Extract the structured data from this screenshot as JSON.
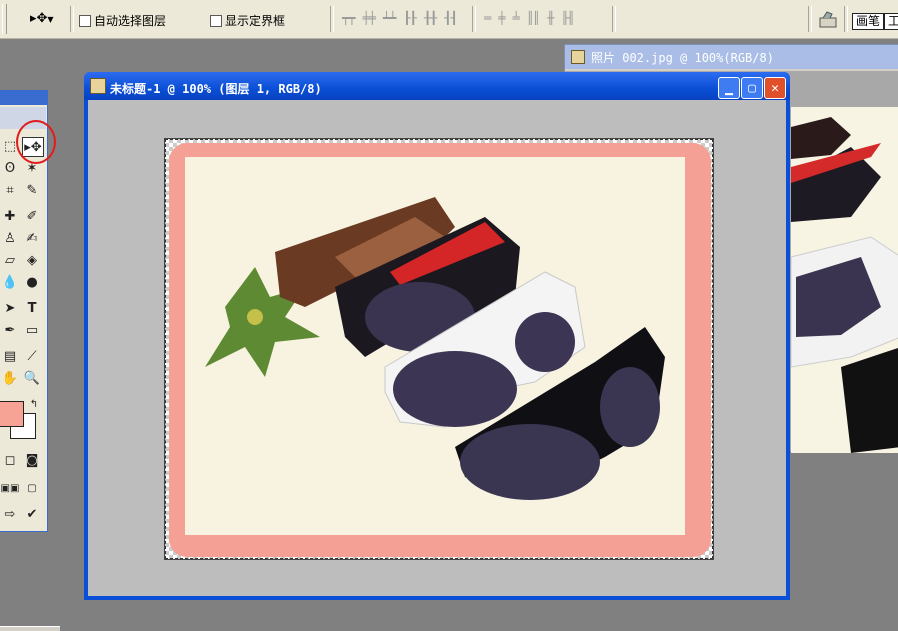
{
  "options_bar": {
    "auto_select_label": "自动选择图层",
    "show_bounds_label": "显示定界框",
    "brush_tab": "画笔",
    "tool_tab": "工"
  },
  "doc2": {
    "title": "照片 002.jpg @ 100%(RGB/8)"
  },
  "doc_main": {
    "title": "未标题-1 @ 100% (图层 1, RGB/8)"
  },
  "colors": {
    "foreground": "#f6a396",
    "background": "#ffffff",
    "window_blue": "#0a4fd6"
  }
}
